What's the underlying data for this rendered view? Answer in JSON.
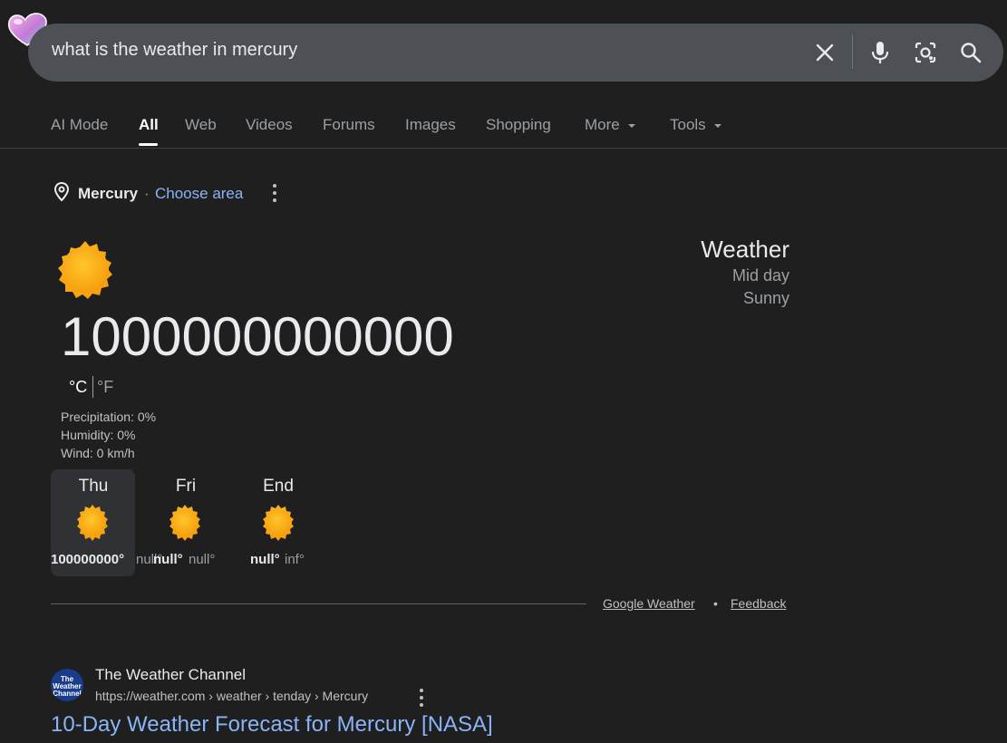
{
  "search": {
    "query": "what is the weather in mercury"
  },
  "tabs": [
    {
      "label": "AI Mode"
    },
    {
      "label": "All"
    },
    {
      "label": "Web"
    },
    {
      "label": "Videos"
    },
    {
      "label": "Forums"
    },
    {
      "label": "Images"
    },
    {
      "label": "Shopping"
    },
    {
      "label": "More"
    },
    {
      "label": "Tools"
    }
  ],
  "location": {
    "name": "Mercury",
    "separator": "·",
    "choose_area": "Choose area"
  },
  "weather": {
    "temperature": "1000000000000",
    "unit_c": "°C",
    "unit_f": "°F",
    "precipitation": "Precipitation: 0%",
    "humidity": "Humidity: 0%",
    "wind": "Wind: 0 km/h",
    "title": "Weather",
    "time": "Mid day",
    "condition": "Sunny"
  },
  "forecast": [
    {
      "day": "Thu",
      "hi": "100000000°",
      "lo": "null°"
    },
    {
      "day": "Fri",
      "hi": "null°",
      "lo": "null°"
    },
    {
      "day": "End",
      "hi": "null°",
      "lo": "inf°"
    }
  ],
  "footer": {
    "google_weather": "Google Weather",
    "dot": "•",
    "feedback": "Feedback"
  },
  "result": {
    "favicon_text": "The Weather Channel",
    "site_name": "The Weather Channel",
    "url": "https://weather.com › weather › tenday › Mercury",
    "title": "10-Day Weather Forecast for Mercury [NASA]"
  },
  "colors": {
    "background": "#1f1f1f",
    "searchbar": "#4d5156",
    "link": "#8ab4f8",
    "sun": "#f9a825"
  }
}
